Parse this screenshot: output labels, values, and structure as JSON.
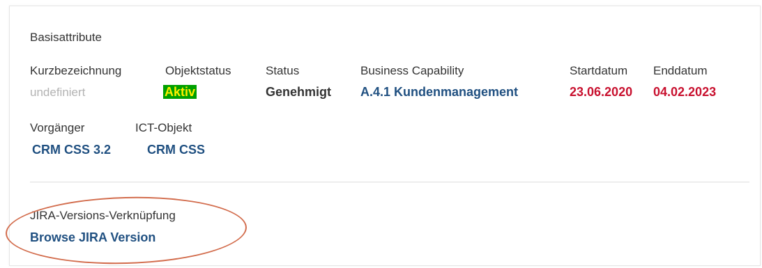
{
  "section_title": "Basisattribute",
  "fields": {
    "kurzbezeichnung": {
      "label": "Kurzbezeichnung",
      "value": "undefiniert"
    },
    "objektstatus": {
      "label": "Objektstatus",
      "value": "Aktiv"
    },
    "status": {
      "label": "Status",
      "value": "Genehmigt"
    },
    "business_capability": {
      "label": "Business Capability",
      "value": "A.4.1 Kundenmanagement"
    },
    "startdatum": {
      "label": "Startdatum",
      "value": "23.06.2020"
    },
    "enddatum": {
      "label": "Enddatum",
      "value": "04.02.2023"
    },
    "vorgaenger": {
      "label": "Vorgänger",
      "value": "CRM CSS 3.2"
    },
    "ict_objekt": {
      "label": "ICT-Objekt",
      "value": "CRM CSS"
    }
  },
  "jira": {
    "label": "JIRA-Versions-Verknüpfung",
    "link": "Browse JIRA Version"
  },
  "colors": {
    "link": "#205081",
    "date": "#c8102e",
    "status_badge_bg": "#00a000",
    "status_badge_text": "#ffef00",
    "highlight_circle": "#d26b4b"
  }
}
